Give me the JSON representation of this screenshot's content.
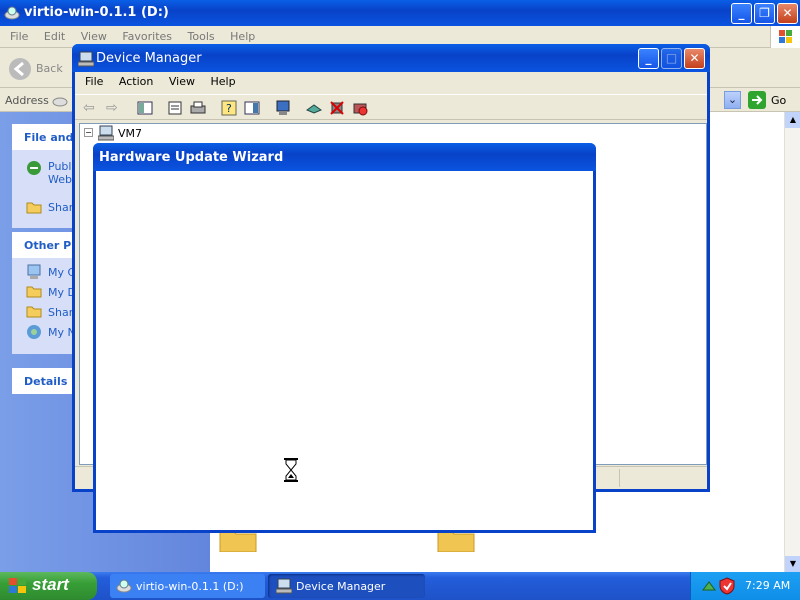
{
  "explorer": {
    "title": "virtio-win-0.1.1 (D:)",
    "menu": [
      "File",
      "Edit",
      "View",
      "Favorites",
      "Tools",
      "Help"
    ],
    "back_label": "Back",
    "address_label": "Address",
    "go_label": "Go",
    "panels": {
      "file_and": {
        "title": "File and",
        "items": [
          "Publi",
          "Web",
          "Shar"
        ]
      },
      "other_places": {
        "title": "Other Pl",
        "items": [
          "My C",
          "My D",
          "Shar",
          "My N"
        ]
      },
      "details": {
        "title": "Details"
      }
    }
  },
  "device_manager": {
    "title": "Device Manager",
    "menu": [
      "File",
      "Action",
      "View",
      "Help"
    ],
    "tree_root": "VM7"
  },
  "wizard": {
    "title": "Hardware Update Wizard"
  },
  "taskbar": {
    "start_label": "start",
    "tasks": [
      "virtio-win-0.1.1 (D:)",
      "Device Manager"
    ],
    "clock": "7:29 AM"
  },
  "colors": {
    "xp_blue": "#0a54e0",
    "start_green": "#3c9a3c",
    "taskbar_blue": "#245edb",
    "tray_blue": "#0f8ee8"
  }
}
